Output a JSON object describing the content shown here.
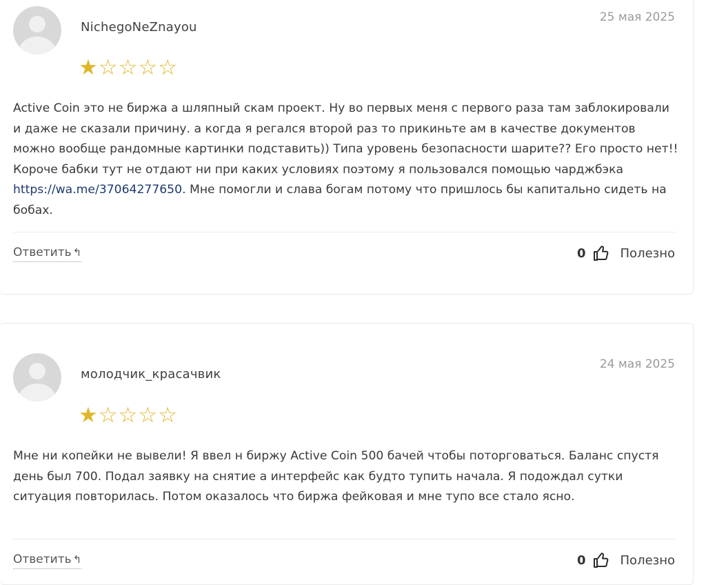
{
  "reviews": [
    {
      "author": "NichegoNeZnayou",
      "date": "25 мая 2025",
      "rating": 1,
      "text_before_link": "Active Coin это не биржа а шляпный скам проект. Ну во первых меня с первого раза там заблокировали и даже не сказали причину. а когда я регался второй раз то прикиньте ам в качестве документов можно вообще рандомные картинки подставить)) Типа уровень безопасности шарите?? Его просто нет!! Короче бабки тут не отдают ни при каких условиях поэтому я пользовался помощью чарджбэка ",
      "link": "https://wa.me/37064277650",
      "text_after_link": ". Мне помогли и слава богам потому что пришлось бы капитально сидеть на бобах.",
      "reply_label": "Ответить",
      "votes": "0",
      "helpful_label": "Полезно"
    },
    {
      "author": "молодчик_красачвик",
      "date": "24 мая 2025",
      "rating": 1,
      "text": "Мне ни копейки не вывели! Я ввел н биржу Active Coin 500 бачей чтобы поторговаться. Баланс спустя день был 700. Подал заявку на снятие а интерфейс как будто тупить начала. Я подождал сутки ситуация повторилась. Потом оказалось что биржа фейковая и мне тупо все стало ясно.",
      "reply_label": "Ответить",
      "votes": "0",
      "helpful_label": "Полезно"
    }
  ],
  "icons": {
    "star_filled": "★",
    "star_empty": "☆",
    "reply_arrow": "↰"
  },
  "colors": {
    "star": "#dfb72c",
    "link": "#1e3a6e",
    "date": "#9a9a9a"
  }
}
